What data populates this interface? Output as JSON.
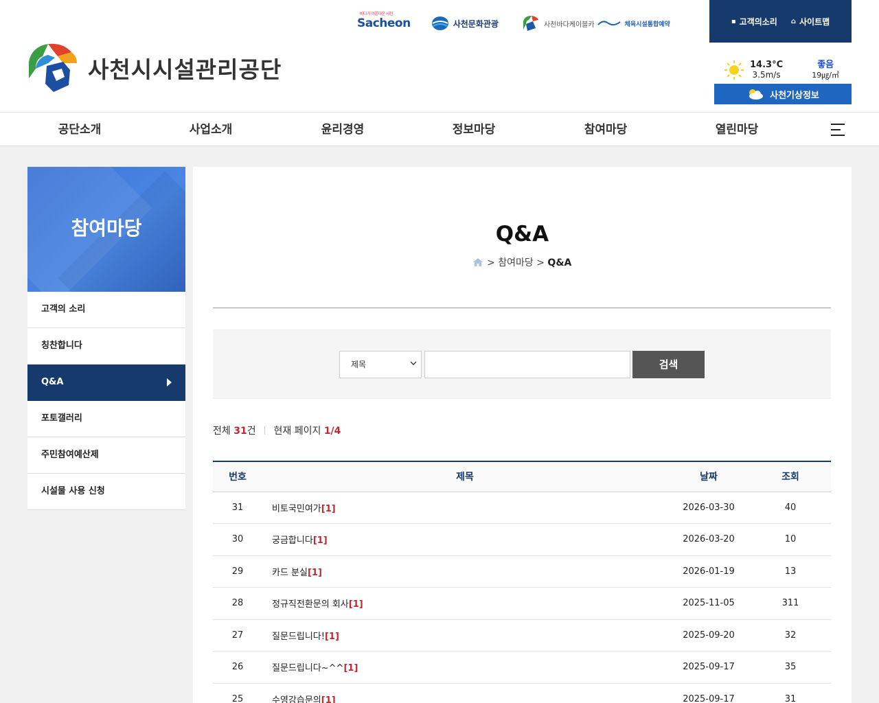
{
  "header": {
    "top_links": {
      "sacheon": "Sacheon",
      "sacheon_small": "바다가 아름다운 사천",
      "culture_tour": "사천문화관광",
      "cable_car": "사천바다케이블카",
      "sports_booking": "체육시설통합예약"
    },
    "util": {
      "voice_label": "고객의소리",
      "sitemap_label": "사이트맵"
    },
    "logo_text": "사천시시설관리공단",
    "weather": {
      "temperature": "14.3°C",
      "wind": "3.5m/s",
      "air_grade": "좋음",
      "air_value": "19㎍/㎥",
      "button_label": "사천기상정보"
    }
  },
  "gnb": {
    "items": [
      "공단소개",
      "사업소개",
      "윤리경영",
      "정보마당",
      "참여마당",
      "열린마당"
    ]
  },
  "lnb": {
    "title": "참여마당",
    "items": [
      "고객의 소리",
      "칭찬합니다",
      "Q&A",
      "포토갤러리",
      "주민참여예산제",
      "시설물 사용 신청"
    ],
    "active_index": 2
  },
  "page": {
    "title": "Q&A",
    "breadcrumb_sep": ">",
    "breadcrumb_parent": "참여마당",
    "breadcrumb_current": "Q&A"
  },
  "search": {
    "field_selected": "제목",
    "keyword": "",
    "button_label": "검색"
  },
  "summary": {
    "total_label": "전체",
    "total_count": "31",
    "total_unit": "건",
    "page_label": "현재 페이지",
    "page_value": "1/4"
  },
  "table": {
    "headers": [
      "번호",
      "제목",
      "날짜",
      "조회"
    ],
    "rows": [
      {
        "no": "31",
        "subject": "비토국민여가",
        "comments": "[1]",
        "date": "2026-03-30",
        "views": "40"
      },
      {
        "no": "30",
        "subject": "궁금합니다",
        "comments": "[1]",
        "date": "2026-03-20",
        "views": "10"
      },
      {
        "no": "29",
        "subject": "카드 분실",
        "comments": "[1]",
        "date": "2026-01-19",
        "views": "13"
      },
      {
        "no": "28",
        "subject": "정규직전환문의 회사",
        "comments": "[1]",
        "date": "2025-11-05",
        "views": "311"
      },
      {
        "no": "27",
        "subject": "질문드립니다!",
        "comments": "[1]",
        "date": "2025-09-20",
        "views": "32"
      },
      {
        "no": "26",
        "subject": "질문드립니다~^^",
        "comments": "[1]",
        "date": "2025-09-17",
        "views": "35"
      },
      {
        "no": "25",
        "subject": "수영강습문의",
        "comments": "[1]",
        "date": "2025-09-17",
        "views": "31"
      }
    ]
  },
  "colors": {
    "navy": "#163a6b",
    "blue": "#1f66c1",
    "accent_red": "#c4262e"
  },
  "icons": {
    "sitemap": "home-icon",
    "voice": "document-icon",
    "weather": "sun-icon",
    "weather_btn": "cloud-icon",
    "menu": "hamburger-icon",
    "breadcrumb_home": "home-icon"
  }
}
